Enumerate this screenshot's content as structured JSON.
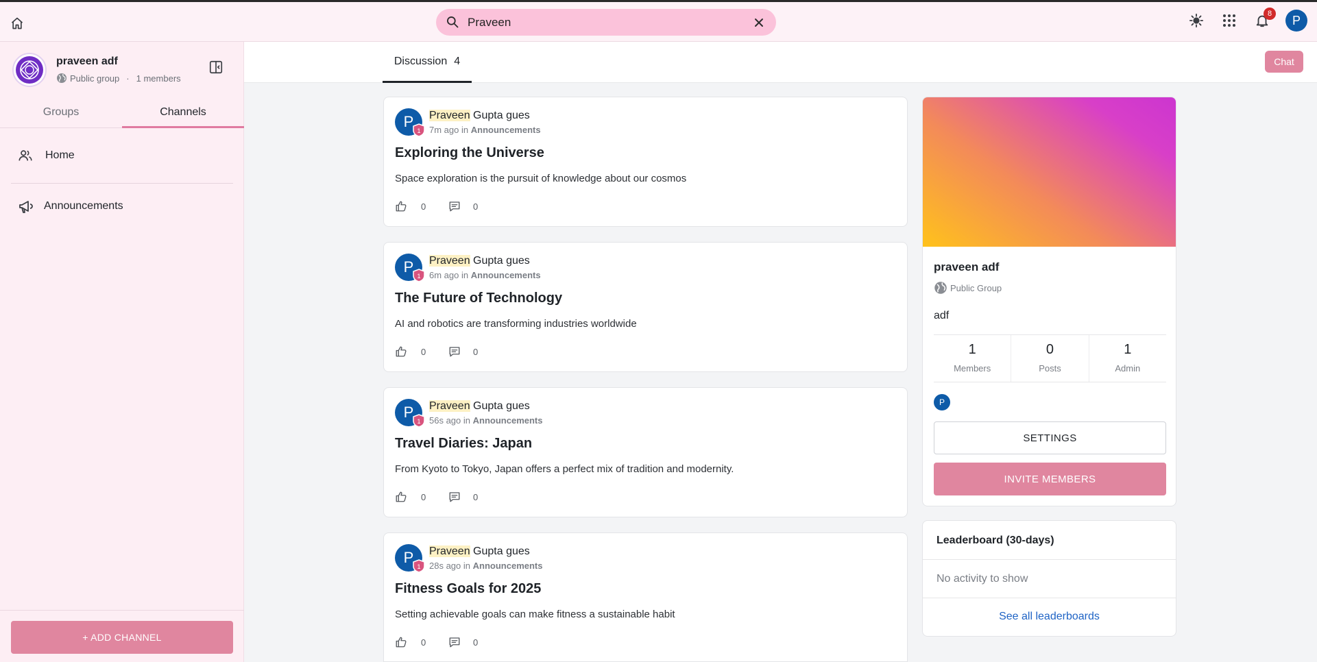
{
  "topbar": {
    "search_value": "Praveen",
    "notification_count": "8",
    "user_initial": "P"
  },
  "sidebar": {
    "group_name": "praveen adf",
    "group_visibility": "Public group",
    "group_dot": "·",
    "group_members": "1 members",
    "tabs": [
      {
        "label": "Groups",
        "active": false
      },
      {
        "label": "Channels",
        "active": true
      }
    ],
    "nav": [
      {
        "label": "Home",
        "icon": "people-icon"
      },
      {
        "label": "Announcements",
        "icon": "megaphone-icon"
      }
    ],
    "add_channel_label": "+ ADD CHANNEL"
  },
  "main": {
    "tab_label": "Discussion",
    "tab_count": "4",
    "chat_label": "Chat"
  },
  "posts": [
    {
      "author_highlight": "Praveen",
      "author_rest": "Gupta gues",
      "time": "7m ago",
      "in": "in",
      "channel": "Announcements",
      "title": "Exploring the Universe",
      "body": "Space exploration is the pursuit of knowledge about our cosmos",
      "likes": "0",
      "comments": "0",
      "badge": "1",
      "initial": "P"
    },
    {
      "author_highlight": "Praveen",
      "author_rest": "Gupta gues",
      "time": "6m ago",
      "in": "in",
      "channel": "Announcements",
      "title": "The Future of Technology",
      "body": "AI and robotics are transforming industries worldwide",
      "likes": "0",
      "comments": "0",
      "badge": "1",
      "initial": "P"
    },
    {
      "author_highlight": "Praveen",
      "author_rest": "Gupta gues",
      "time": "56s ago",
      "in": "in",
      "channel": "Announcements",
      "title": "Travel Diaries: Japan",
      "body": "From Kyoto to Tokyo, Japan offers a perfect mix of tradition and modernity.",
      "likes": "0",
      "comments": "0",
      "badge": "1",
      "initial": "P"
    },
    {
      "author_highlight": "Praveen",
      "author_rest": "Gupta gues",
      "time": "28s ago",
      "in": "in",
      "channel": "Announcements",
      "title": "Fitness Goals for 2025",
      "body": "Setting achievable goals can make fitness a sustainable habit",
      "likes": "0",
      "comments": "0",
      "badge": "1",
      "initial": "P"
    }
  ],
  "info": {
    "name": "praveen adf",
    "type": "Public Group",
    "description": "adf",
    "stats": [
      {
        "num": "1",
        "label": "Members"
      },
      {
        "num": "0",
        "label": "Posts"
      },
      {
        "num": "1",
        "label": "Admin"
      }
    ],
    "member_initial": "P",
    "settings_label": "SETTINGS",
    "invite_label": "INVITE MEMBERS"
  },
  "leaderboard": {
    "title": "Leaderboard (30-days)",
    "empty": "No activity to show",
    "link": "See all leaderboards"
  },
  "colors": {
    "accent": "#e0869f",
    "search_bg": "#fbc2da",
    "avatar": "#0e5ba8",
    "link": "#1e63c5"
  }
}
